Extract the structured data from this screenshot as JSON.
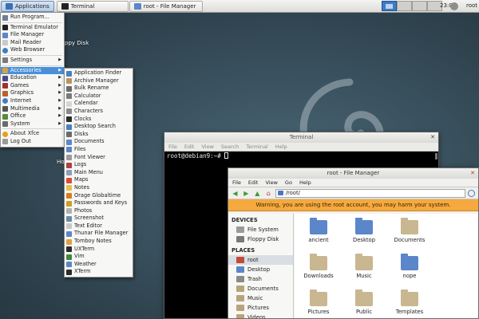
{
  "panel": {
    "applications_label": "Applications",
    "task_terminal": "Terminal",
    "task_file_manager": "root - File Manager",
    "clock": "23:08",
    "user": "root"
  },
  "desktop": {
    "icons": [
      {
        "label": "ppy Disk"
      },
      {
        "label": "Ho"
      }
    ]
  },
  "apps_menu": {
    "items": [
      {
        "label": "Run Program...",
        "icon": "run-icon"
      },
      {
        "label": "Terminal Emulator",
        "icon": "terminal-icon"
      },
      {
        "label": "File Manager",
        "icon": "folder-icon"
      },
      {
        "label": "Mail Reader",
        "icon": "mail-icon"
      },
      {
        "label": "Web Browser",
        "icon": "globe-icon"
      },
      {
        "label": "Settings",
        "icon": "settings-icon",
        "submenu": true
      },
      {
        "label": "Accessories",
        "icon": "accessories-icon",
        "submenu": true,
        "highlighted": true
      },
      {
        "label": "Education",
        "icon": "education-icon",
        "submenu": true
      },
      {
        "label": "Games",
        "icon": "games-icon",
        "submenu": true
      },
      {
        "label": "Graphics",
        "icon": "graphics-icon",
        "submenu": true
      },
      {
        "label": "Internet",
        "icon": "internet-icon",
        "submenu": true
      },
      {
        "label": "Multimedia",
        "icon": "multimedia-icon",
        "submenu": true
      },
      {
        "label": "Office",
        "icon": "office-icon",
        "submenu": true
      },
      {
        "label": "System",
        "icon": "system-icon",
        "submenu": true
      },
      {
        "label": "About Xfce",
        "icon": "info-icon"
      },
      {
        "label": "Log Out",
        "icon": "logout-icon"
      }
    ]
  },
  "accessories_menu": {
    "items": [
      "Application Finder",
      "Archive Manager",
      "Bulk Rename",
      "Calculator",
      "Calendar",
      "Characters",
      "Clocks",
      "Desktop Search",
      "Disks",
      "Documents",
      "Files",
      "Font Viewer",
      "Logs",
      "Main Menu",
      "Maps",
      "Notes",
      "Orage Globaltime",
      "Passwords and Keys",
      "Photos",
      "Screenshot",
      "Text Editor",
      "Thunar File Manager",
      "Tomboy Notes",
      "UXTerm",
      "Vim",
      "Weather",
      "XTerm"
    ]
  },
  "terminal": {
    "title": "Terminal",
    "menu": [
      "File",
      "Edit",
      "View",
      "Search",
      "Terminal",
      "Help"
    ],
    "prompt": "root@debian9:~# "
  },
  "file_manager": {
    "title": "root - File Manager",
    "menu": [
      "File",
      "Edit",
      "View",
      "Go",
      "Help"
    ],
    "path": "/root/",
    "warning": "Warning, you are using the root account, you may harm your system.",
    "devices_header": "DEVICES",
    "devices": [
      "File System",
      "Floppy Disk"
    ],
    "places_header": "PLACES",
    "places": [
      "root",
      "Desktop",
      "Trash",
      "Documents",
      "Music",
      "Pictures",
      "Videos"
    ],
    "files": [
      "ancient",
      "Desktop",
      "Documents",
      "Downloads",
      "Music",
      "nope",
      "Pictures",
      "Public",
      "Templates"
    ]
  },
  "colors": {
    "highlight": "#4a90d9",
    "warning_bar": "#f5a93e",
    "folder_tan": "#c8b790",
    "folder_blue": "#5b86c9"
  }
}
